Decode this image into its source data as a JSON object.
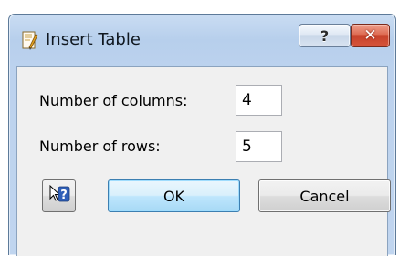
{
  "window": {
    "title": "Insert Table",
    "help_caption_glyph": "?",
    "close_caption_glyph": "✕"
  },
  "form": {
    "columns_label": "Number of columns:",
    "columns_value": "4",
    "rows_label": "Number of rows:",
    "rows_value": "5"
  },
  "buttons": {
    "ok_label": "OK",
    "cancel_label": "Cancel"
  },
  "icons": {
    "app": "document-pen-icon",
    "help_caption": "question-mark-icon",
    "close_caption": "close-icon",
    "context_help": "context-help-pointer-icon"
  },
  "colors": {
    "frame": "#c0d5ef",
    "close_button": "#c7412a",
    "default_button_border": "#3c7fb1"
  }
}
